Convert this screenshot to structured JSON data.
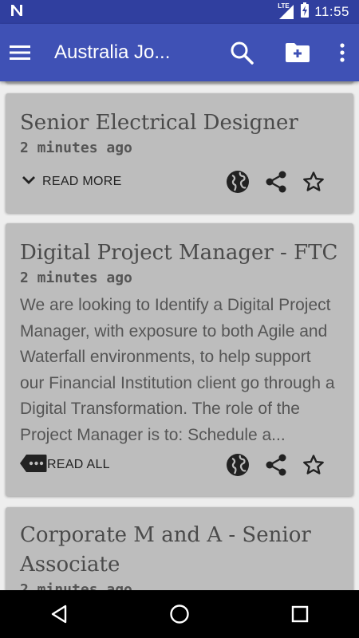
{
  "status_bar": {
    "network_label": "LTE",
    "time": "11:55"
  },
  "app_bar": {
    "title": "Australia Jo..."
  },
  "jobs": [
    {
      "title": "Senior Electrical Designer",
      "time": "2 minutes ago",
      "description": "",
      "action_label": "READ MORE"
    },
    {
      "title": "Digital Project Manager - FTC",
      "time": "2 minutes ago",
      "description": "We are looking to Identify a Digital Project Manager, with exposure to both Agile and Waterfall environments, to help support our Financial Institution client go through a Digital Transformation. The role of the Project Manager is to: Schedule a...",
      "action_label": "READ ALL"
    },
    {
      "title": "Corporate M and A - Senior Associate",
      "time": "2 minutes ago",
      "description": "",
      "action_label": ""
    }
  ],
  "colors": {
    "status_bar": "#303f9f",
    "app_bar": "#3f51b5",
    "card": "#bdbdbd",
    "background": "#eeeeee"
  },
  "icons": [
    "menu-icon",
    "search-icon",
    "add-folder-icon",
    "more-vert-icon",
    "globe-icon",
    "share-icon",
    "star-outline-icon",
    "chevron-down-icon",
    "ellipsis-tag-icon",
    "back-icon",
    "home-icon",
    "recents-icon"
  ]
}
